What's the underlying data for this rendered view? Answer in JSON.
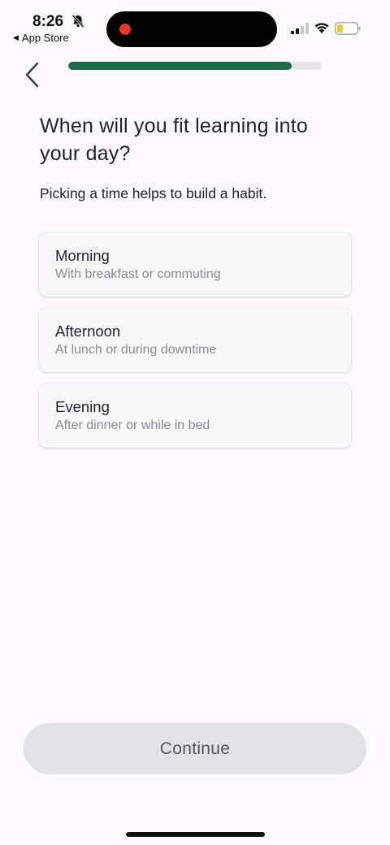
{
  "status_bar": {
    "time": "8:26",
    "back_app_label": "App Store",
    "icons": [
      "bell-slash-icon",
      "cellular-signal-icon",
      "wifi-icon",
      "battery-icon"
    ],
    "recording_color": "#e2382f"
  },
  "progress": {
    "value": 0.88,
    "fill_color": "#1f6a4d"
  },
  "page": {
    "title": "When will you fit learning into your day?",
    "subtitle": "Picking a time helps to build a habit."
  },
  "options": [
    {
      "title": "Morning",
      "subtitle": "With breakfast or commuting"
    },
    {
      "title": "Afternoon",
      "subtitle": "At lunch or during downtime"
    },
    {
      "title": "Evening",
      "subtitle": "After dinner or while in bed"
    }
  ],
  "continue_label": "Continue"
}
